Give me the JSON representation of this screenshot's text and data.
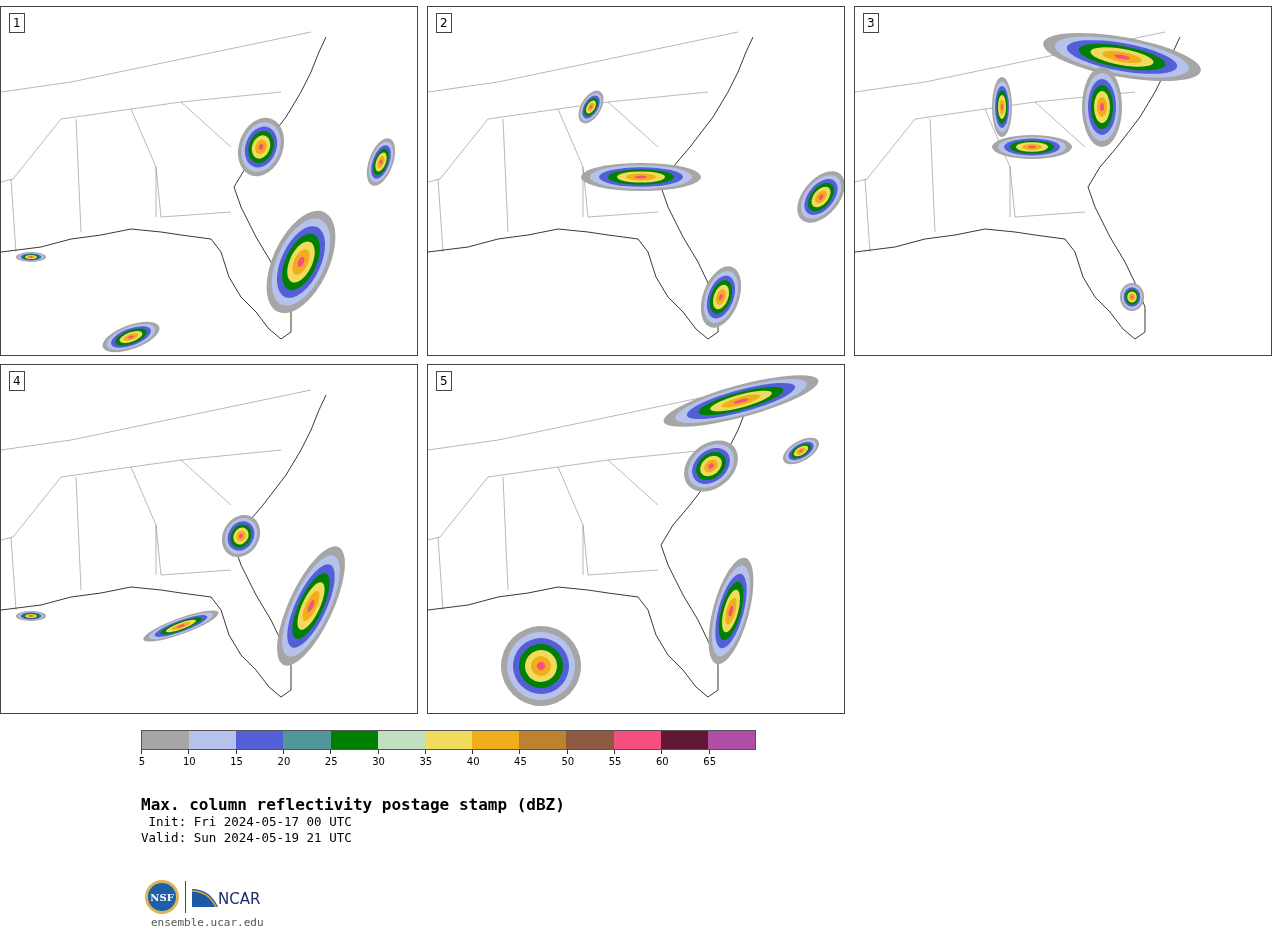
{
  "panels": [
    {
      "label": "1"
    },
    {
      "label": "2"
    },
    {
      "label": "3"
    },
    {
      "label": "4"
    },
    {
      "label": "5"
    }
  ],
  "colorbar": {
    "bins": [
      {
        "color": "#a6a6a6"
      },
      {
        "color": "#b7c2ec"
      },
      {
        "color": "#525fd6"
      },
      {
        "color": "#50969a"
      },
      {
        "color": "#008000"
      },
      {
        "color": "#bfdfbf"
      },
      {
        "color": "#f0db5c"
      },
      {
        "color": "#f0ae1a"
      },
      {
        "color": "#bd8230"
      },
      {
        "color": "#8c5a40"
      },
      {
        "color": "#f55080"
      },
      {
        "color": "#611837"
      },
      {
        "color": "#b04fa5"
      }
    ],
    "ticks": [
      "5",
      "10",
      "15",
      "20",
      "25",
      "30",
      "35",
      "40",
      "45",
      "50",
      "55",
      "60",
      "65"
    ]
  },
  "title": "Max. column reflectivity postage stamp (dBZ)",
  "init": " Init: Fri 2024-05-17 00 UTC",
  "valid": "Valid: Sun 2024-05-19 21 UTC",
  "logo": {
    "seal": "NSF",
    "wordmark": "NCAR"
  },
  "url": "ensemble.ucar.edu"
}
